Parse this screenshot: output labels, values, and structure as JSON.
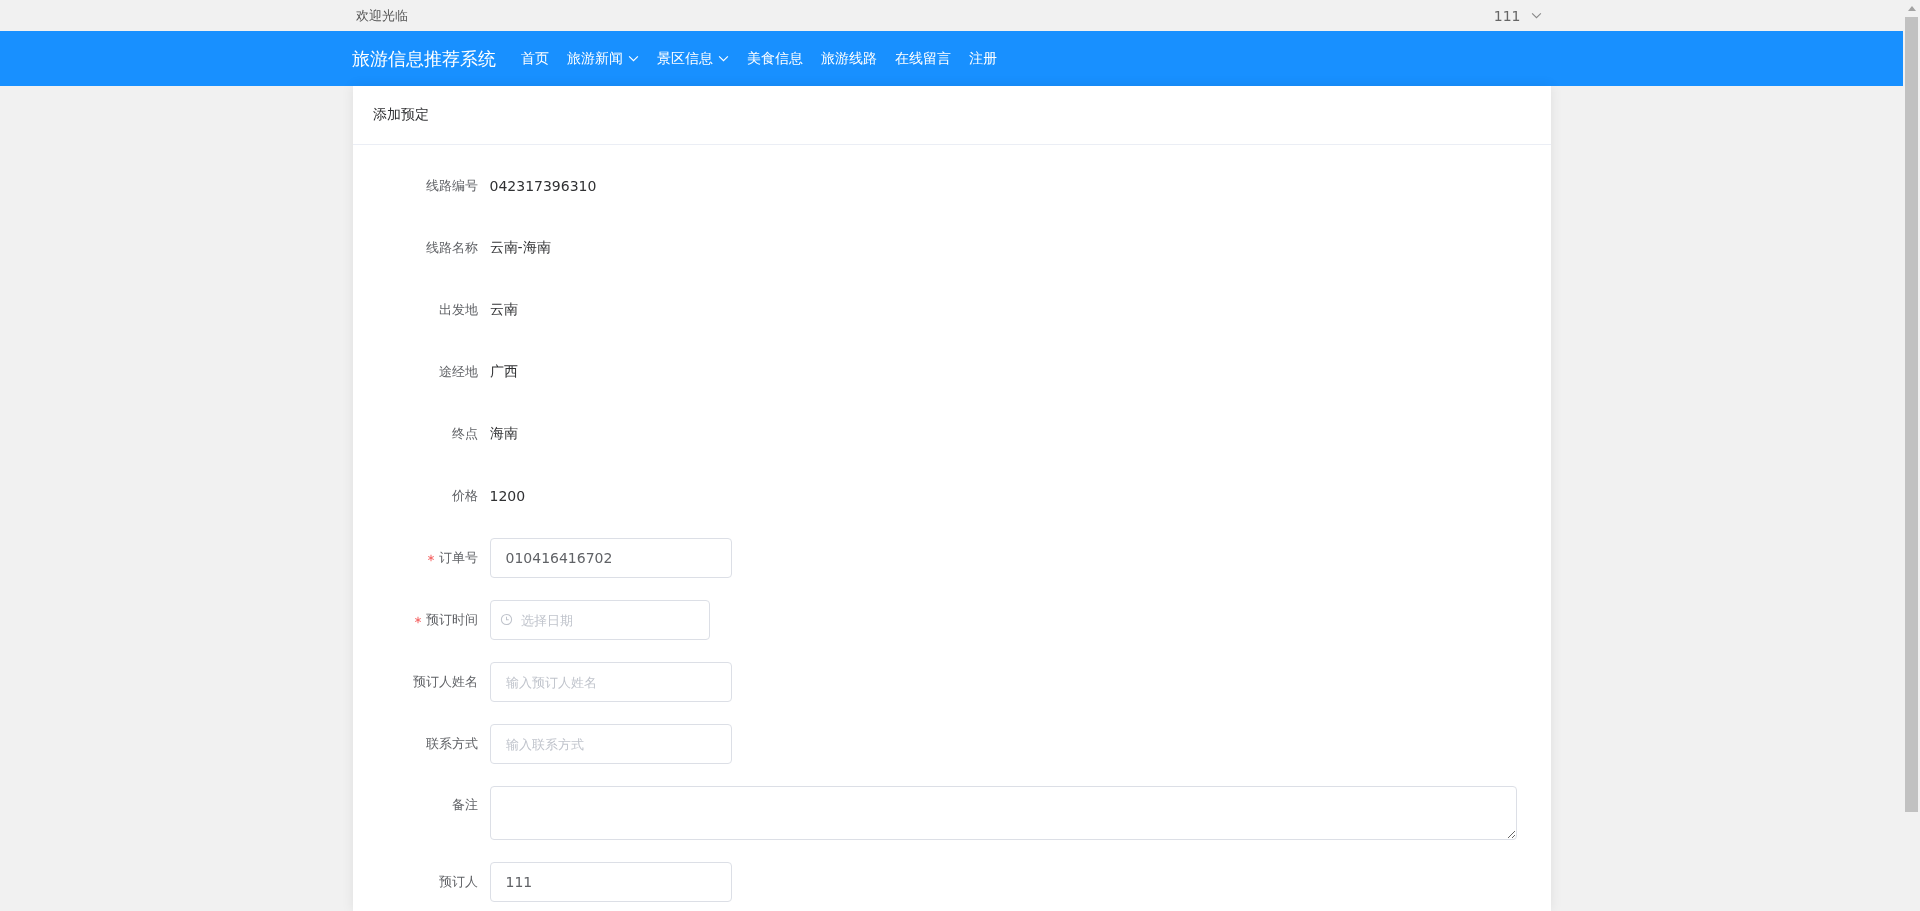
{
  "top_bar": {
    "welcome": "欢迎光临",
    "user": "111"
  },
  "nav": {
    "brand": "旅游信息推荐系统",
    "items": [
      {
        "label": "首页",
        "kind": "link"
      },
      {
        "label": "旅游新闻",
        "kind": "dropdown"
      },
      {
        "label": "景区信息",
        "kind": "dropdown"
      },
      {
        "label": "美食信息",
        "kind": "link"
      },
      {
        "label": "旅游线路",
        "kind": "link"
      },
      {
        "label": "在线留言",
        "kind": "link"
      },
      {
        "label": "注册",
        "kind": "link"
      }
    ]
  },
  "card": {
    "title": "添加预定",
    "fields": [
      {
        "label": "线路编号",
        "kind": "text",
        "required": false,
        "value": "042317396310"
      },
      {
        "label": "线路名称",
        "kind": "text",
        "required": false,
        "value": "云南-海南"
      },
      {
        "label": "出发地",
        "kind": "text",
        "required": false,
        "value": "云南"
      },
      {
        "label": "途经地",
        "kind": "text",
        "required": false,
        "value": "广西"
      },
      {
        "label": "终点",
        "kind": "text",
        "required": false,
        "value": "海南"
      },
      {
        "label": "价格",
        "kind": "text",
        "required": false,
        "value": "1200"
      },
      {
        "label": "订单号",
        "kind": "input",
        "required": true,
        "value": "010416416702"
      },
      {
        "label": "预订时间",
        "kind": "date",
        "required": true,
        "placeholder": "选择日期"
      },
      {
        "label": "预订人姓名",
        "kind": "input",
        "required": false,
        "placeholder": "输入预订人姓名"
      },
      {
        "label": "联系方式",
        "kind": "input",
        "required": false,
        "placeholder": "输入联系方式"
      },
      {
        "label": "备注",
        "kind": "textarea",
        "required": false
      },
      {
        "label": "预订人",
        "kind": "input",
        "required": false,
        "value": "111"
      }
    ]
  }
}
